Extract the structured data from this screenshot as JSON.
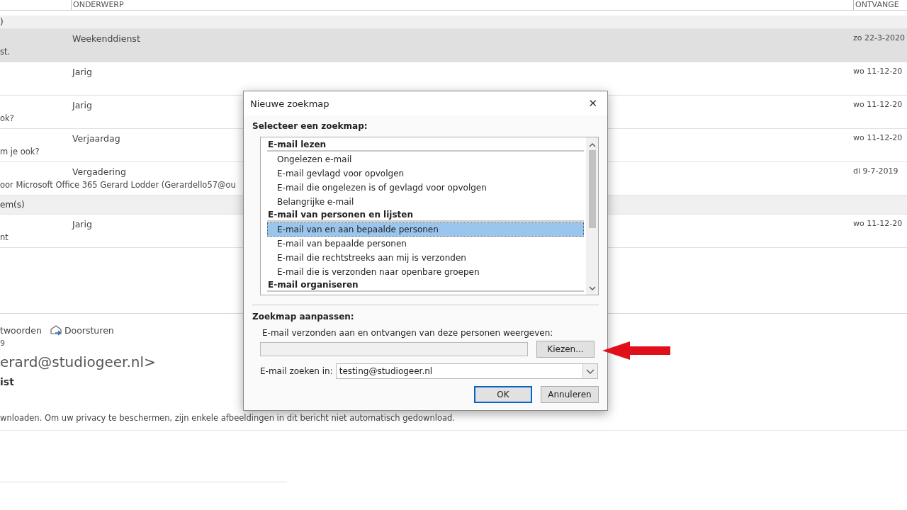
{
  "mail_list": {
    "columns": [
      "ONDERWERP",
      "ONTVANGE"
    ],
    "groups": [
      {
        "label": ")",
        "rows": [
          {
            "subject": "Weekenddienst",
            "preview": "st.",
            "date": "zo 22-3-2020",
            "selected": true
          },
          {
            "subject": "Jarig",
            "preview": "",
            "date": "wo 11-12-20",
            "selected": false
          },
          {
            "subject": "Jarig",
            "preview": "ok?",
            "date": "wo 11-12-20",
            "selected": false
          },
          {
            "subject": "Verjaardag",
            "preview": "m je ook?",
            "date": "wo 11-12-20",
            "selected": false
          },
          {
            "subject": "Vergadering",
            "preview": "oor Microsoft Office 365  Gerard Lodder (Gerardello57@ou",
            "date": "di 9-7-2019",
            "selected": false
          }
        ]
      },
      {
        "label": "em(s)",
        "rows": [
          {
            "subject": "Jarig",
            "preview": "nt",
            "date": "wo 11-12-20",
            "selected": false
          }
        ]
      }
    ]
  },
  "reading_pane": {
    "actions": [
      {
        "kind": "reply",
        "label": "twoorden"
      },
      {
        "kind": "forward",
        "label": "Doorsturen"
      }
    ],
    "date": "9",
    "sender": "erard@studiogeer.nl>",
    "subject": "ist",
    "notice": "wnloaden. Om uw privacy te beschermen, zijn enkele afbeeldingen in dit bericht niet automatisch gedownload."
  },
  "dialog": {
    "title": "Nieuwe zoekmap",
    "close": "✕",
    "list_label": "Selecteer een zoekmap:",
    "list": [
      {
        "kind": "category",
        "label": "E-mail lezen",
        "selected": false
      },
      {
        "kind": "item",
        "label": "Ongelezen e-mail",
        "selected": false
      },
      {
        "kind": "item",
        "label": "E-mail gevlagd voor opvolgen",
        "selected": false
      },
      {
        "kind": "item",
        "label": "E-mail die ongelezen is of gevlagd voor opvolgen",
        "selected": false
      },
      {
        "kind": "item",
        "label": "Belangrijke e-mail",
        "selected": false
      },
      {
        "kind": "category",
        "label": "E-mail van personen en lijsten",
        "selected": false
      },
      {
        "kind": "item",
        "label": "E-mail van en aan bepaalde personen",
        "selected": true
      },
      {
        "kind": "item",
        "label": "E-mail van bepaalde personen",
        "selected": false
      },
      {
        "kind": "item",
        "label": "E-mail die rechtstreeks aan mij is verzonden",
        "selected": false
      },
      {
        "kind": "item",
        "label": "E-mail die is verzonden naar openbare groepen",
        "selected": false
      },
      {
        "kind": "category",
        "label": "E-mail organiseren",
        "selected": false
      }
    ],
    "customize_label": "Zoekmap aanpassen:",
    "people_label": "E-mail verzonden aan en ontvangen van deze personen weergeven:",
    "choose_button": "Kiezen...",
    "search_in_label": "E-mail zoeken in:",
    "search_in_value": "testing@studiogeer.nl",
    "buttons": [
      {
        "label": "OK",
        "default": true
      },
      {
        "label": "Annuleren",
        "default": false
      }
    ]
  }
}
